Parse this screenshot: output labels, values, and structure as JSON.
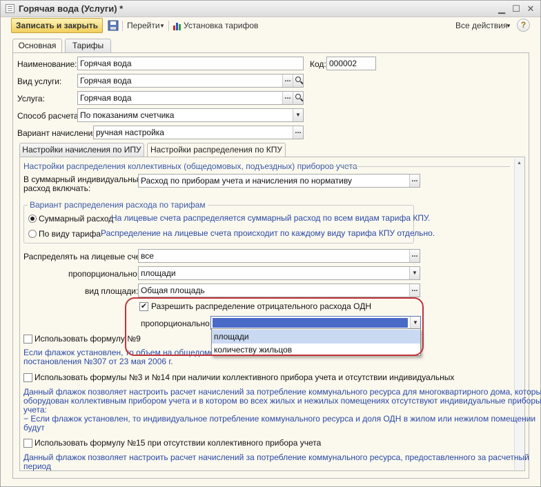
{
  "window": {
    "title": "Горячая вода (Услуги) *"
  },
  "toolbar": {
    "save_close": "Записать и закрыть",
    "goto": "Перейти",
    "set_tariffs": "Установка тарифов",
    "all_actions": "Все действия",
    "help": "?"
  },
  "tabs_main": [
    "Основная",
    "Тарифы"
  ],
  "form": {
    "name_label": "Наименование:",
    "name_value": "Горячая вода",
    "code_label": "Код:",
    "code_value": "000002",
    "service_kind_label": "Вид услуги:",
    "service_kind_value": "Горячая вода",
    "service_label": "Услуга:",
    "service_value": "Горячая вода",
    "calc_method_label": "Способ расчета:",
    "calc_method_value": "По показаниям счетчика",
    "accrual_label": "Вариант начисления:",
    "accrual_value": "ручная настройка"
  },
  "tabs_sub": [
    "Настройки начисления по ИПУ",
    "Настройки распределения по КПУ"
  ],
  "kpu": {
    "section_title": "Настройки распределения коллективных (общедомовых, подъездных) приборов учета",
    "total_label_1": "В суммарный индивидуальный",
    "total_label_2": "расход включать:",
    "total_value": "Расход по приборам учета и начисления по нормативу",
    "group_title": "Вариант распределения расхода по тарифам",
    "radio1_label": "Суммарный расход",
    "radio1_desc": "На лицевые счета распределяется суммарный расход по всем видам тарифа КПУ.",
    "radio2_label": "По виду тарифа",
    "radio2_desc": "Распределение на лицевые счета происходит по каждому виду тарифа КПУ отдельно.",
    "distribute_label": "Распределять на лицевые счета:",
    "distribute_value": "все",
    "proportional_label": "пропорционально:",
    "proportional_value": "площади",
    "area_kind_label": "вид площади:",
    "area_kind_value": "Общая площадь",
    "negative_label": "Разрешить распределение отрицательного расхода ОДН",
    "negative_prop_label": "пропорционально:",
    "negative_prop_value": "",
    "dropdown_options": [
      "площади",
      "количеству жильцов"
    ],
    "formula9_label": "Использовать формулу №9",
    "formula9_desc_1": "Если флажок установлен, то объем на общедомовые",
    "formula9_desc_2": "постановления №307 от 23 мая 2006 г.",
    "formula3_label": "Использовать формулы №3 и №14 при наличии коллективного прибора учета и отсутствии индивидуальных",
    "formula3_desc_1": "Данный флажок позволяет настроить расчет начислений за потребление коммунального ресурса для многоквартирного дома, который",
    "formula3_desc_2": "оборудован коллективным прибором учета и в котором во всех жилых и нежилых помещениях отсутствуют индивидуальные приборы",
    "formula3_desc_3": "учета:",
    "formula3_desc_4": "− Если флажок установлен, то индивидуальное потребление коммунального ресурса и доля ОДН в жилом или нежилом помещении",
    "formula3_desc_5": "будут",
    "formula15_label": "Использовать формулу №15 при отсутствии коллективного прибора учета",
    "formula15_desc_1": "Данный флажок позволяет настроить расчет начислений за потребление коммунального ресурса, предоставленного за расчетный",
    "formula15_desc_2": "период"
  },
  "colors": {
    "accent": "#f0cf5b",
    "link_text": "#2a48a8",
    "highlight": "#c0323a",
    "select_fill": "#4a6ac8"
  }
}
